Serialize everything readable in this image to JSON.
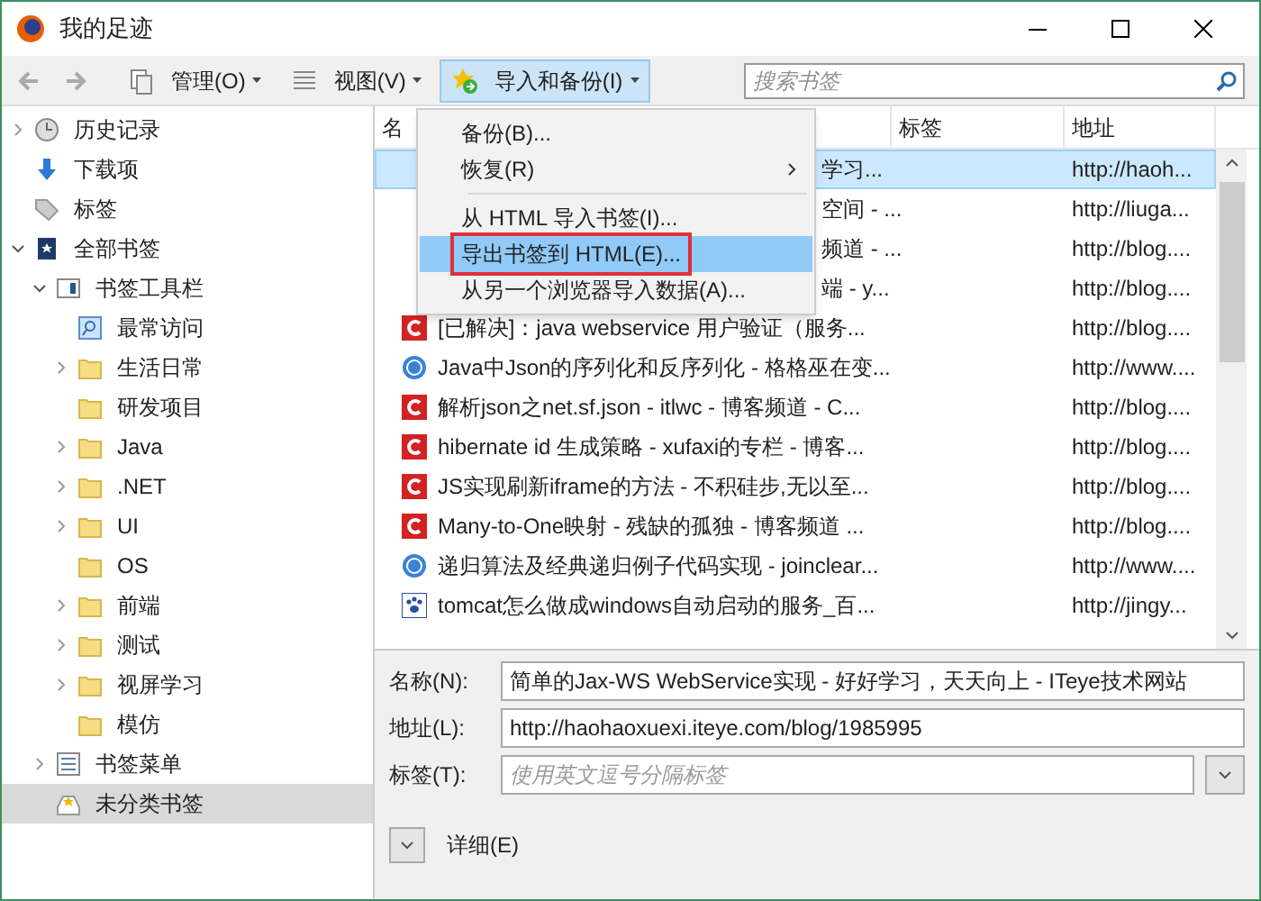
{
  "window": {
    "title": "我的足迹"
  },
  "toolbar": {
    "buttons": [
      {
        "label": "管理(O)",
        "pressed": false
      },
      {
        "label": "视图(V)",
        "pressed": false
      },
      {
        "label": "导入和备份(I)",
        "pressed": true
      }
    ],
    "search": {
      "placeholder": "搜索书签"
    }
  },
  "sidebar": {
    "items": [
      {
        "label": "历史记录",
        "kind": "clock",
        "expanded": false,
        "selected": false
      },
      {
        "label": "下载项",
        "kind": "download",
        "selected": false
      },
      {
        "label": "标签",
        "kind": "tag",
        "selected": false
      },
      {
        "label": "全部书签",
        "kind": "star-book",
        "expanded": true,
        "selected": false,
        "children": [
          {
            "label": "书签工具栏",
            "kind": "toolbar",
            "expanded": true,
            "selected": false,
            "children": [
              {
                "label": "最常访问",
                "kind": "smart",
                "selected": false
              },
              {
                "label": "生活日常",
                "kind": "folder",
                "expanded": false,
                "selected": false
              },
              {
                "label": "研发项目",
                "kind": "folder",
                "selected": false
              },
              {
                "label": "Java",
                "kind": "folder",
                "expanded": false,
                "selected": false
              },
              {
                "label": ".NET",
                "kind": "folder",
                "expanded": false,
                "selected": false
              },
              {
                "label": "UI",
                "kind": "folder",
                "expanded": false,
                "selected": false
              },
              {
                "label": "OS",
                "kind": "folder",
                "selected": false
              },
              {
                "label": "前端",
                "kind": "folder",
                "expanded": false,
                "selected": false
              },
              {
                "label": "测试",
                "kind": "folder",
                "expanded": false,
                "selected": false
              },
              {
                "label": "视屏学习",
                "kind": "folder",
                "expanded": false,
                "selected": false
              },
              {
                "label": "模仿",
                "kind": "folder",
                "selected": false
              }
            ]
          },
          {
            "label": "书签菜单",
            "kind": "menu",
            "expanded": false,
            "selected": false
          },
          {
            "label": "未分类书签",
            "kind": "unsorted",
            "selected": true
          }
        ]
      }
    ]
  },
  "table": {
    "columns": [
      "名",
      "标签",
      "地址"
    ],
    "rows": [
      {
        "kind": "covered",
        "name": "学习...",
        "address": "http://haoh...",
        "selected": true
      },
      {
        "kind": "covered",
        "name": "空间 - ...",
        "address": "http://liuga...",
        "selected": false
      },
      {
        "kind": "covered",
        "name": "频道 - ...",
        "address": "http://blog....",
        "selected": false
      },
      {
        "kind": "covered",
        "name": "端 - y...",
        "address": "http://blog....",
        "selected": false
      },
      {
        "kind": "red",
        "name": "[已解决]：java webservice 用户验证（服务...",
        "address": "http://blog....",
        "selected": false
      },
      {
        "kind": "globe",
        "name": "Java中Json的序列化和反序列化 - 格格巫在变...",
        "address": "http://www....",
        "selected": false
      },
      {
        "kind": "red",
        "name": "解析json之net.sf.json - itlwc - 博客频道 - C...",
        "address": "http://blog....",
        "selected": false
      },
      {
        "kind": "red",
        "name": "hibernate id 生成策略 - xufaxi的专栏 - 博客...",
        "address": "http://blog....",
        "selected": false
      },
      {
        "kind": "red",
        "name": "JS实现刷新iframe的方法 - 不积硅步,无以至...",
        "address": "http://blog....",
        "selected": false
      },
      {
        "kind": "red",
        "name": "Many-to-One映射 - 残缺的孤独 - 博客频道 ...",
        "address": "http://blog....",
        "selected": false
      },
      {
        "kind": "globe",
        "name": "递归算法及经典递归例子代码实现 - joinclear...",
        "address": "http://www....",
        "selected": false
      },
      {
        "kind": "paw",
        "name": "tomcat怎么做成windows自动启动的服务_百...",
        "address": "http://jingy...",
        "selected": false
      }
    ]
  },
  "menu": {
    "items": [
      {
        "kind": "item",
        "label": "备份(B)...",
        "highlighted": false
      },
      {
        "kind": "submenu",
        "label": "恢复(R)",
        "highlighted": false
      },
      {
        "kind": "separator"
      },
      {
        "kind": "item",
        "label": "从 HTML 导入书签(I)...",
        "highlighted": false
      },
      {
        "kind": "item",
        "label": "导出书签到 HTML(E)...",
        "highlighted": true
      },
      {
        "kind": "item",
        "label": "从另一个浏览器导入数据(A)...",
        "highlighted": false
      }
    ]
  },
  "details": {
    "fields": [
      {
        "label": "名称(N):",
        "value": "简单的Jax-WS WebService实现 - 好好学习，天天向上 - ITeye技术网站"
      },
      {
        "label": "地址(L):",
        "value": "http://haohaoxuexi.iteye.com/blog/1985995"
      },
      {
        "label": "标签(T):",
        "placeholder": "使用英文逗号分隔标签"
      }
    ],
    "more": "详细(E)"
  }
}
